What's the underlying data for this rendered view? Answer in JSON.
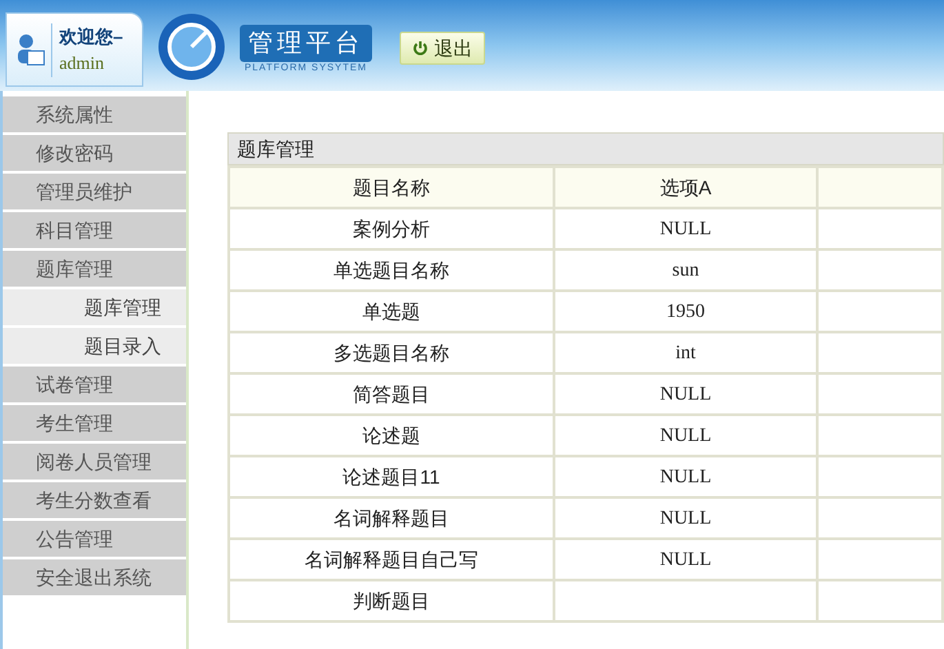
{
  "header": {
    "greeting": "欢迎您–",
    "user": "admin",
    "brand_title": "管理平台",
    "brand_subtitle": "PLATFORM SYSYTEM",
    "logout": "退出"
  },
  "sidebar": {
    "items": [
      {
        "label": "系统属性",
        "kind": "main"
      },
      {
        "label": "修改密码",
        "kind": "main"
      },
      {
        "label": "管理员维护",
        "kind": "main"
      },
      {
        "label": "科目管理",
        "kind": "main"
      },
      {
        "label": "题库管理",
        "kind": "main"
      },
      {
        "label": "题库管理",
        "kind": "sub"
      },
      {
        "label": "题目录入",
        "kind": "sub"
      },
      {
        "label": "试卷管理",
        "kind": "main"
      },
      {
        "label": "考生管理",
        "kind": "main"
      },
      {
        "label": "阅卷人员管理",
        "kind": "main"
      },
      {
        "label": "考生分数查看",
        "kind": "main"
      },
      {
        "label": "公告管理",
        "kind": "main"
      },
      {
        "label": "安全退出系统",
        "kind": "main"
      }
    ]
  },
  "panel": {
    "title": "题库管理",
    "table": {
      "columns": [
        "题目名称",
        "选项A"
      ],
      "rows": [
        [
          "案例分析",
          "NULL"
        ],
        [
          "单选题目名称",
          "sun"
        ],
        [
          "单选题",
          "1950"
        ],
        [
          "多选题目名称",
          "int"
        ],
        [
          "简答题目",
          "NULL"
        ],
        [
          "论述题",
          "NULL"
        ],
        [
          "论述题目11",
          "NULL"
        ],
        [
          "名词解释题目",
          "NULL"
        ],
        [
          "名词解释题目自己写",
          "NULL"
        ],
        [
          "判断题目"
        ]
      ]
    }
  }
}
